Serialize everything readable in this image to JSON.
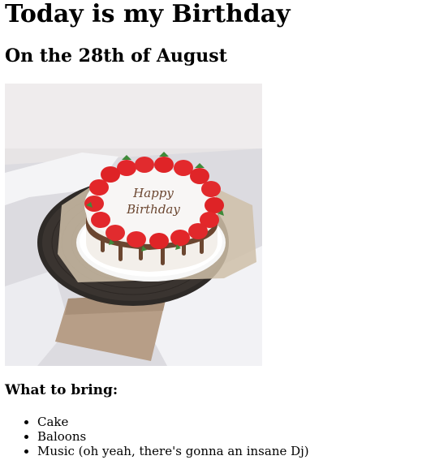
{
  "page": {
    "title": "Today is my Birthday",
    "subtitle": "On the 28th of August",
    "image": {
      "icon": "birthday-cake-photo",
      "cake_text": [
        "Happy",
        "Birthday"
      ]
    },
    "bring_heading": "What to bring:",
    "bring_items": [
      "Cake",
      "Baloons",
      "Music (oh yeah, there's gonna an insane Dj)"
    ]
  },
  "colors": {
    "text": "#000000",
    "background": "#ffffff",
    "strawberry": "#e2262b",
    "chocolate": "#6b4630",
    "cake_stand": "#2a2622"
  }
}
